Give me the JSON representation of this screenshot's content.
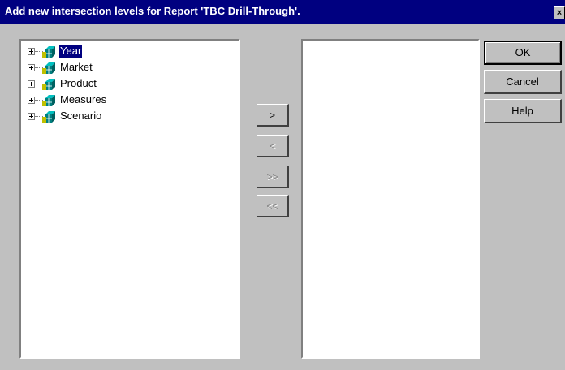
{
  "dialog": {
    "title": "Add new intersection levels for Report 'TBC Drill-Through'.",
    "close_label": "×"
  },
  "tree": {
    "items": [
      {
        "label": "Year",
        "selected": true
      },
      {
        "label": "Market",
        "selected": false
      },
      {
        "label": "Product",
        "selected": false
      },
      {
        "label": "Measures",
        "selected": false
      },
      {
        "label": "Scenario",
        "selected": false
      }
    ]
  },
  "transfer": {
    "add": ">",
    "remove": "<",
    "add_all": ">>",
    "remove_all": "<<"
  },
  "buttons": {
    "ok": "OK",
    "cancel": "Cancel",
    "help": "Help"
  },
  "icons": {
    "tree_node": "dimension-cube-icon",
    "expander": "plus-expander-icon",
    "close": "close-icon"
  }
}
